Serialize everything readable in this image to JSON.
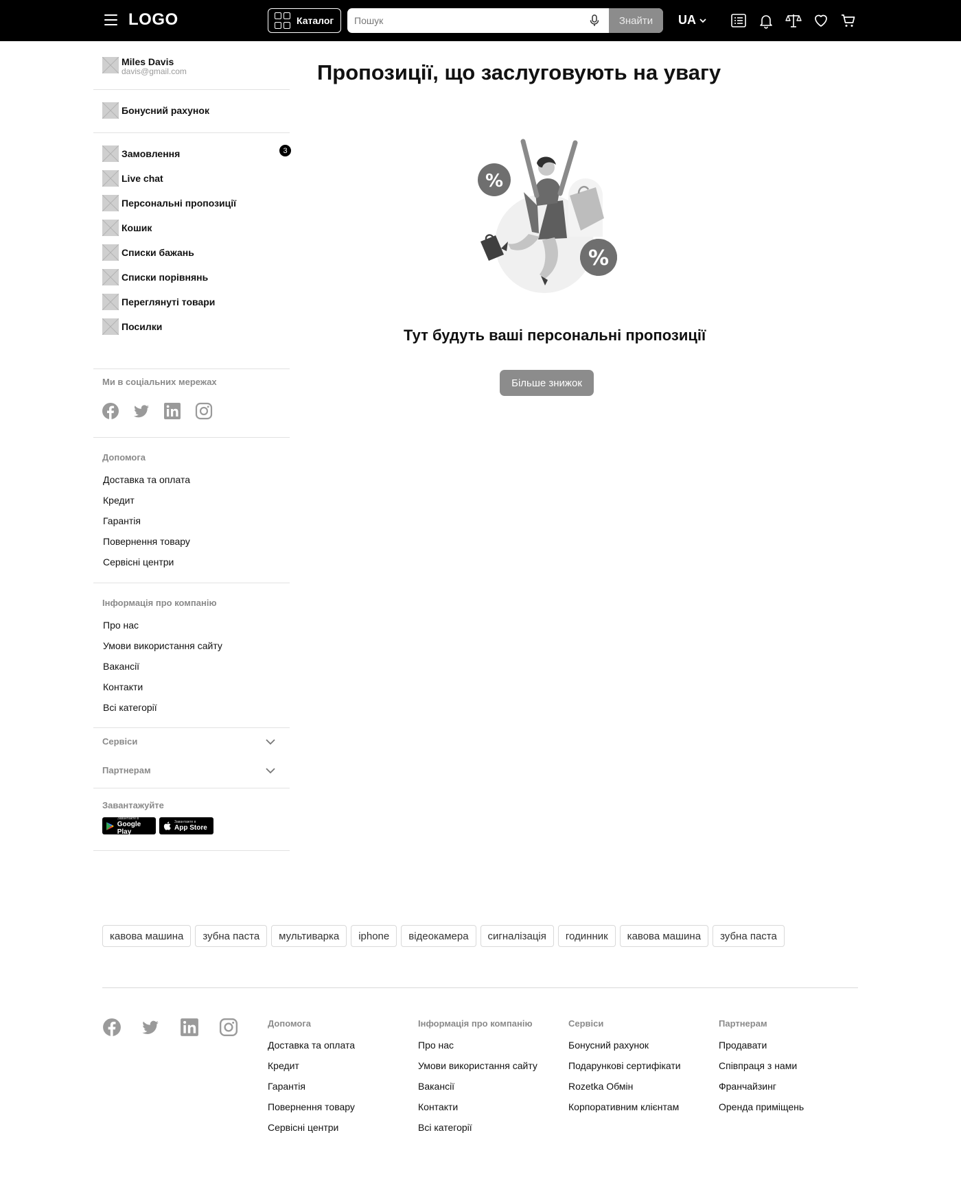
{
  "header": {
    "logo": "LOGO",
    "catalog_label": "Каталог",
    "search_placeholder": "Пошук",
    "search_button": "Знайти",
    "language": "UA"
  },
  "user": {
    "name": "Miles Davis",
    "email": "davis@gmail.com"
  },
  "sidebar": {
    "bonus": "Бонусний рахунок",
    "items": [
      {
        "label": "Замовлення"
      },
      {
        "label": "Live chat"
      },
      {
        "label": "Персональні пропозиції"
      },
      {
        "label": "Кошик"
      },
      {
        "label": "Списки бажань"
      },
      {
        "label": "Списки порівнянь"
      },
      {
        "label": "Переглянуті товари"
      },
      {
        "label": "Посилки"
      }
    ],
    "orders_badge": "3",
    "social_title": "Ми в соціальних мережах",
    "help": {
      "title": "Допомога",
      "links": [
        "Доставка та оплата",
        "Кредит",
        "Гарантія",
        "Повернення товару",
        "Сервісні центри"
      ]
    },
    "company": {
      "title": "Інформація про компанію",
      "links": [
        "Про нас",
        "Умови використання сайту",
        "Вакансії",
        "Контакти",
        "Всі категорії"
      ]
    },
    "services_title": "Сервіси",
    "partners_title": "Партнерам",
    "download_title": "Завантажуйте",
    "google_play": {
      "small": "Завантажте в",
      "big": "Google Play"
    },
    "app_store": {
      "small": "Завантажте в",
      "big": "App Store"
    }
  },
  "main": {
    "title": "Пропозиції, що заслуговують на увагу",
    "empty_text": "Тут будуть ваші персональні пропозиції",
    "more_button": "Більше знижок"
  },
  "tags": [
    "кавова машина",
    "зубна паста",
    "мультиварка",
    "iphone",
    "відеокамера",
    "сигналізація",
    "годинник",
    "кавова машина",
    "зубна паста"
  ],
  "footer": {
    "help": {
      "title": "Допомога",
      "links": [
        "Доставка та оплата",
        "Кредит",
        "Гарантія",
        "Повернення товару",
        "Сервісні центри"
      ]
    },
    "company": {
      "title": "Інформація про компанію",
      "links": [
        "Про нас",
        "Умови використання сайту",
        "Вакансії",
        "Контакти",
        "Всі категорії"
      ]
    },
    "services": {
      "title": "Сервіси",
      "links": [
        "Бонусний рахунок",
        "Подарункові сертифікати",
        "Rozetka Обмін",
        "Корпоративним клієнтам"
      ]
    },
    "partners": {
      "title": "Партнерам",
      "links": [
        "Продавати",
        "Співпраця з нами",
        "Франчайзинг",
        "Оренда приміщень"
      ]
    }
  },
  "icons": {
    "header": [
      "menu-icon",
      "grid-icon",
      "microphone-icon",
      "chevron-down-icon",
      "list-icon",
      "bell-icon",
      "scales-icon",
      "heart-icon",
      "cart-icon"
    ],
    "social": [
      "facebook-icon",
      "twitter-icon",
      "linkedin-icon",
      "instagram-icon"
    ]
  },
  "colors": {
    "header_bg": "#000000",
    "button_gray": "#8c8c8c",
    "muted_text": "#8a8a8a",
    "divider": "#e2e2e2"
  }
}
